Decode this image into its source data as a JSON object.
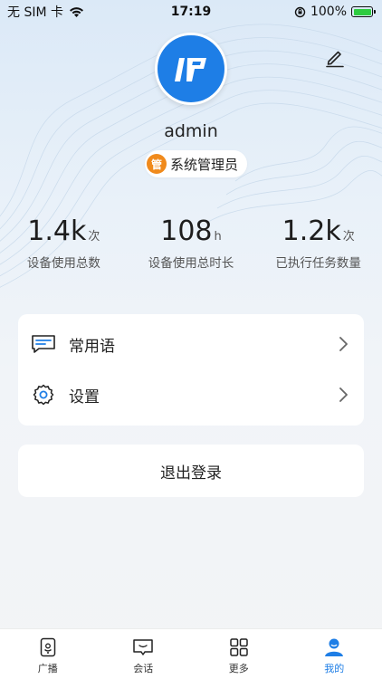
{
  "status_bar": {
    "carrier": "无 SIM 卡",
    "time": "17:19",
    "battery": "100%"
  },
  "profile": {
    "username": "admin",
    "role_icon_char": "管",
    "role": "系统管理员"
  },
  "stats": [
    {
      "value": "1.4k",
      "unit": "次",
      "label": "设备使用总数"
    },
    {
      "value": "108",
      "unit": "h",
      "label": "设备使用总时长"
    },
    {
      "value": "1.2k",
      "unit": "次",
      "label": "已执行任务数量"
    }
  ],
  "menu": [
    {
      "label": "常用语",
      "icon": "chat-message-icon"
    },
    {
      "label": "设置",
      "icon": "gear-icon"
    }
  ],
  "logout": {
    "label": "退出登录"
  },
  "tabs": [
    {
      "label": "广播",
      "icon": "broadcast-icon",
      "active": false
    },
    {
      "label": "会话",
      "icon": "conversation-icon",
      "active": false
    },
    {
      "label": "更多",
      "icon": "grid-icon",
      "active": false
    },
    {
      "label": "我的",
      "icon": "user-icon",
      "active": true
    }
  ],
  "colors": {
    "accent": "#1e7ee6",
    "role_badge": "#f08a1c",
    "battery": "#2ecc40"
  }
}
